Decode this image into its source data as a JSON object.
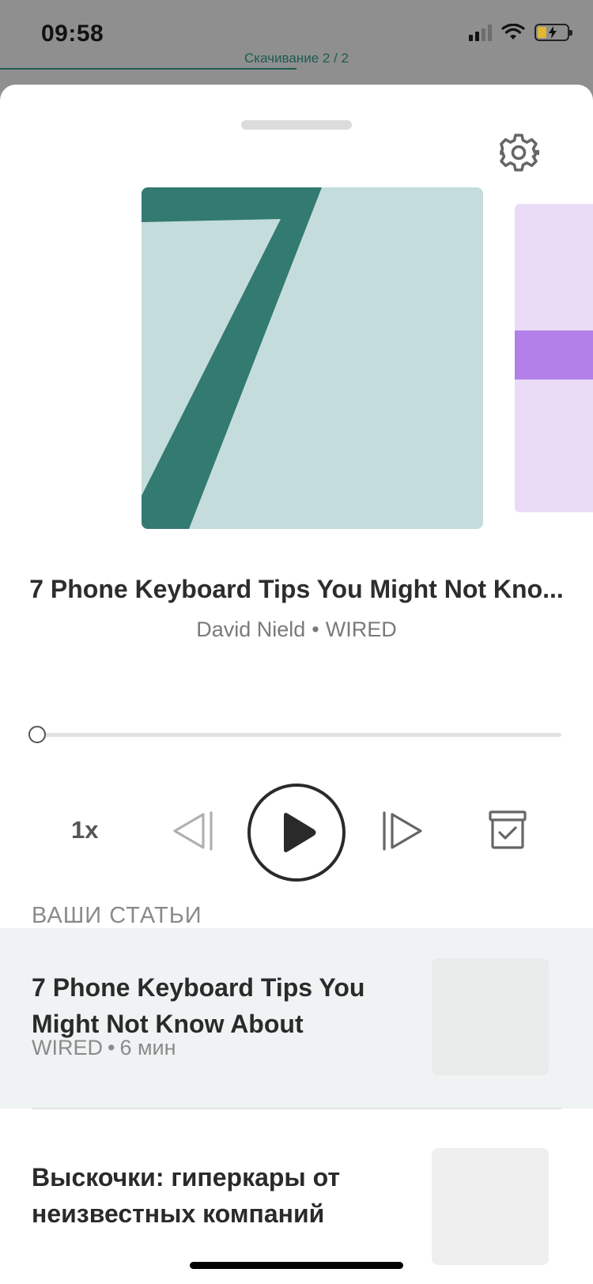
{
  "status_bar": {
    "time": "09:58",
    "download_status": "Скачивание 2 / 2",
    "icons": [
      "cellular-signal-icon",
      "wifi-icon",
      "battery-charging-icon"
    ]
  },
  "player": {
    "article_title": "7 Phone Keyboard Tips You Might Not Kno...",
    "author": "David Nield",
    "byline_separator": "•",
    "source": "WIRED",
    "cover_glyph": "7",
    "cover_colors": {
      "background": "#c4dddc",
      "glyph": "#337a70"
    },
    "next_cover_colors": {
      "background": "#eadcf7",
      "band": "#b37fe8"
    },
    "progress": 0,
    "speed_label": "1x",
    "controls": [
      "settings-icon",
      "rewind-icon",
      "play-icon",
      "forward-icon",
      "archive-icon"
    ]
  },
  "articles": {
    "section_title": "ВАШИ СТАТЬИ",
    "items": [
      {
        "title": "7 Phone Keyboard Tips You Might Not Know About",
        "source": "WIRED",
        "separator": "•",
        "duration": "6 мин"
      },
      {
        "title": "Выскочки: гиперкары от неизвестных компаний"
      }
    ]
  }
}
